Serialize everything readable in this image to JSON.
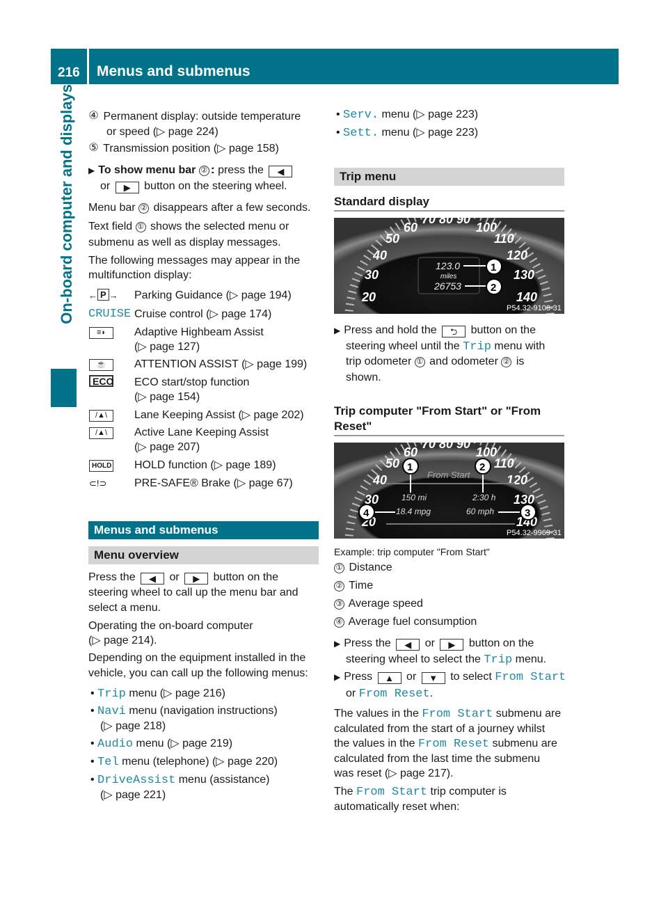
{
  "header": {
    "page_number": "216",
    "title": "Menus and submenus"
  },
  "side_tab": "On-board computer and displays",
  "left": {
    "item4": {
      "num": "④",
      "l1": "Permanent display: outside temperature",
      "l2": "or speed (▷ page 224)"
    },
    "item5": {
      "num": "⑤",
      "l1": "Transmission position (▷ page 158)"
    },
    "show_menu": {
      "bold": "To show menu bar",
      "num": "②",
      "a": ": press the",
      "b": "or",
      "c": "button on the steering wheel."
    },
    "p1": {
      "a": "Menu bar",
      "num": "②",
      "b": "disappears after a few seconds."
    },
    "p2": {
      "a": "Text field",
      "num": "①",
      "b": "shows the selected menu or",
      "l2": "submenu as well as display messages."
    },
    "p3": {
      "l1": "The following messages may appear in the",
      "l2": "multifunction display:"
    },
    "messages": [
      {
        "icon": "←P→",
        "l1": "Parking Guidance (▷ page 194)"
      },
      {
        "icon": "CRUISE",
        "l1": "Cruise control (▷ page 174)"
      },
      {
        "icon": "≡◗",
        "l1": "Adaptive Highbeam Assist",
        "l2": "(▷ page 127)"
      },
      {
        "icon": "☕",
        "l1": "ATTENTION ASSIST (▷ page 199)"
      },
      {
        "icon": "ECO",
        "l1": "ECO start/stop function",
        "l2": "(▷ page 154)"
      },
      {
        "icon": "/▲\\",
        "l1": "Lane Keeping Assist (▷ page 202)"
      },
      {
        "icon": "/▲\\",
        "l1": "Active Lane Keeping Assist",
        "l2": "(▷ page 207)"
      },
      {
        "icon": "HOLD",
        "l1": "HOLD function (▷ page 189)"
      },
      {
        "icon": "⊂!⊃",
        "l1": "PRE-SAFE® Brake (▷ page 67)"
      }
    ],
    "section": "Menus and submenus",
    "overview": "Menu overview",
    "p4": {
      "a": "Press the",
      "b": "or",
      "c": "button on the",
      "l2": "steering wheel to call up the menu bar and",
      "l3": "select a menu."
    },
    "p5": {
      "l1": "Operating the on-board computer",
      "l2": "(▷ page 214)."
    },
    "p6": {
      "l1": "Depending on the equipment installed in the",
      "l2": "vehicle, you can call up the following menus:"
    },
    "menus": [
      {
        "name": "Trip",
        "rest": "menu (▷ page 216)"
      },
      {
        "name": "Navi",
        "rest": "menu (navigation instructions)",
        "l2": "(▷ page 218)"
      },
      {
        "name": "Audio",
        "rest": "menu (▷ page 219)"
      },
      {
        "name": "Tel",
        "rest": "menu (telephone) (▷ page 220)"
      },
      {
        "name": "DriveAssist",
        "rest": "menu (assistance)",
        "l2": "(▷ page 221)"
      }
    ]
  },
  "right": {
    "menus": [
      {
        "name": "Serv.",
        "rest": "menu (▷ page 223)"
      },
      {
        "name": "Sett.",
        "rest": "menu (▷ page 223)"
      }
    ],
    "trip_menu": "Trip menu",
    "standard_display": "Standard display",
    "img1": {
      "trip": "123.0",
      "unit": "miles",
      "odo": "26753",
      "code": "P54.32-9108-31"
    },
    "step1": {
      "a": "Press and hold the",
      "b": "button on the",
      "c": "steering wheel until the",
      "m": "Trip",
      "d": "menu with",
      "e": "trip odometer",
      "n1": "①",
      "f": "and odometer",
      "n2": "②",
      "g": "is",
      "h": "shown."
    },
    "trip_computer": {
      "l1": "Trip computer \"From Start\" or \"From",
      "l2": "Reset\""
    },
    "img2": {
      "title": "From Start",
      "distance": "150 mi",
      "time": "2:30 h",
      "fuel": "18.4 mpg",
      "speed": "60 mph",
      "code": "P54.32-9969-31"
    },
    "caption": "Example: trip computer \"From Start\"",
    "legend": [
      {
        "num": "①",
        "text": "Distance"
      },
      {
        "num": "②",
        "text": "Time"
      },
      {
        "num": "③",
        "text": "Average speed"
      },
      {
        "num": "④",
        "text": "Average fuel consumption"
      }
    ],
    "step2": {
      "a": "Press the",
      "b": "or",
      "c": "button on the",
      "d": "steering wheel to select the",
      "m": "Trip",
      "e": "menu."
    },
    "step3": {
      "a": "Press",
      "b": "or",
      "c": "to select",
      "m1": "From Start",
      "d": "or",
      "m2": "From Reset",
      "e": "."
    },
    "p7": {
      "a": "The values in the",
      "m1": "From Start",
      "b": "submenu are",
      "l2": "calculated from the start of a journey whilst",
      "c": "the values in the",
      "m2": "From Reset",
      "d": "submenu are",
      "l4": "calculated from the last time the submenu",
      "l5": "was reset (▷ page 217)."
    },
    "p8": {
      "a": "The",
      "m": "From Start",
      "b": "trip computer is",
      "l2": "automatically reset when:"
    }
  },
  "buttons": {
    "left": "◀",
    "right": "▶",
    "up": "▲",
    "down": "▼",
    "back": "⮌"
  },
  "colors": {
    "brand": "#00738a",
    "mono_text": "#1f8aa6"
  }
}
